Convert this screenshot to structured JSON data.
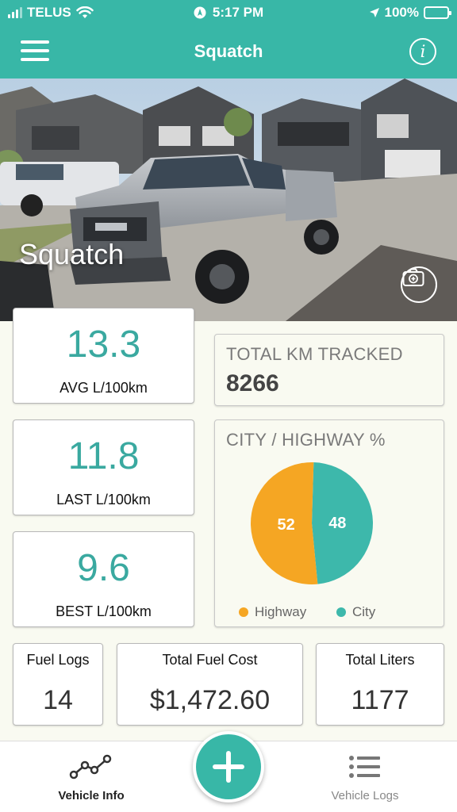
{
  "status_bar": {
    "carrier": "TELUS",
    "time": "5:17 PM",
    "battery": "100%"
  },
  "nav": {
    "title": "Squatch",
    "menu_icon": "hamburger-icon",
    "info_icon": "info-icon",
    "info_glyph": "i"
  },
  "hero": {
    "vehicle_name": "Squatch",
    "camera_icon": "camera-add-icon"
  },
  "stats": [
    {
      "value": "13.3",
      "label": "AVG L/100km"
    },
    {
      "value": "11.8",
      "label": "LAST L/100km"
    },
    {
      "value": "9.6",
      "label": "BEST L/100km"
    }
  ],
  "total_km": {
    "title": "TOTAL KM TRACKED",
    "value": "8266"
  },
  "city_highway": {
    "title": "CITY / HIGHWAY %",
    "legend_highway": "Highway",
    "legend_city": "City"
  },
  "chart_data": {
    "type": "pie",
    "title": "CITY / HIGHWAY %",
    "slices": [
      {
        "name": "Highway",
        "value": 52,
        "label": "52",
        "color": "#f5a623"
      },
      {
        "name": "City",
        "value": 48,
        "label": "48",
        "color": "#3db8ab"
      }
    ],
    "legend": "bottom"
  },
  "summary": [
    {
      "label": "Fuel Logs",
      "value": "14"
    },
    {
      "label": "Total Fuel Cost",
      "value": "$1,472.60"
    },
    {
      "label": "Total Liters",
      "value": "1177"
    }
  ],
  "tabs": {
    "vehicle_info": "Vehicle Info",
    "vehicle_logs": "Vehicle Logs",
    "add_icon": "plus-icon"
  },
  "colors": {
    "accent": "#38b7a7",
    "highway": "#f5a623",
    "city": "#3db8ab"
  }
}
